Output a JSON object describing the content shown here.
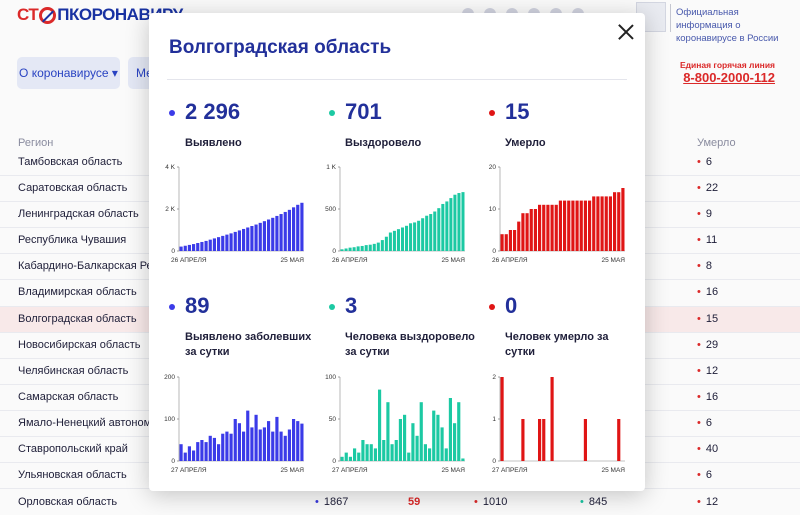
{
  "header": {
    "logo": {
      "part1": "СТ",
      "part2": "ПКОРОНАВИРУ"
    },
    "official": "Официальная информация о коронавирусе в России",
    "nav_about": "О коронавирусе ▾",
    "nav_measures": "Ме",
    "hotline_label": "Единая горячая линия",
    "hotline_phone": "8-800-2000-112"
  },
  "table": {
    "col_region": "Регион",
    "col_deaths": "Умерло",
    "rows": [
      {
        "region": "Тамбовская область",
        "deaths": "6"
      },
      {
        "region": "Саратовская область",
        "deaths": "22"
      },
      {
        "region": "Ленинградская область",
        "deaths": "9"
      },
      {
        "region": "Республика Чувашия",
        "deaths": "11"
      },
      {
        "region": "Кабардино-Балкарская Рес",
        "deaths": "8"
      },
      {
        "region": "Владимирская область",
        "deaths": "16"
      },
      {
        "region": "Волгоградская область",
        "deaths": "15"
      },
      {
        "region": "Новосибирская область",
        "deaths": "29"
      },
      {
        "region": "Челябинская область",
        "deaths": "12"
      },
      {
        "region": "Самарская область",
        "deaths": "16"
      },
      {
        "region": "Ямало-Ненецкий автономн",
        "deaths": "6"
      },
      {
        "region": "Ставропольский край",
        "deaths": "40"
      },
      {
        "region": "Ульяновская область",
        "deaths": "6"
      }
    ],
    "last_row": {
      "region": "Орловская область",
      "cases": "1867",
      "new": "59",
      "recovered": "1010",
      "recovered_new": "845",
      "deaths": "12"
    }
  },
  "modal": {
    "title": "Волгоградская область",
    "stats": [
      {
        "value": "2 296",
        "label": "Выявлено",
        "color": "#3b3be8"
      },
      {
        "value": "701",
        "label": "Выздоровело",
        "color": "#1cc9a3"
      },
      {
        "value": "15",
        "label": "Умерло",
        "color": "#e01515"
      },
      {
        "value": "89",
        "label": "Выявлено заболевших за сутки",
        "color": "#3b3be8"
      },
      {
        "value": "3",
        "label": "Человека выздоровело за сутки",
        "color": "#1cc9a3"
      },
      {
        "value": "0",
        "label": "Человек умерло за сутки",
        "color": "#e01515"
      }
    ]
  },
  "chart_data": [
    {
      "type": "bar",
      "title": "",
      "x_start": "26 АПРЕЛЯ",
      "x_end": "25 МАЯ",
      "yticks": [
        "0",
        "2 K",
        "4 K"
      ],
      "ylim": [
        0,
        4000
      ],
      "color": "#3b3be8",
      "values": [
        210,
        250,
        290,
        330,
        380,
        430,
        480,
        540,
        600,
        660,
        720,
        780,
        840,
        910,
        980,
        1050,
        1120,
        1190,
        1260,
        1340,
        1420,
        1500,
        1580,
        1670,
        1760,
        1860,
        1960,
        2080,
        2200,
        2296
      ]
    },
    {
      "type": "bar",
      "title": "",
      "x_start": "26 АПРЕЛЯ",
      "x_end": "25 МАЯ",
      "yticks": [
        "0",
        "500",
        "1 K"
      ],
      "ylim": [
        0,
        1000
      ],
      "color": "#1cc9a3",
      "values": [
        20,
        30,
        40,
        45,
        55,
        60,
        70,
        75,
        85,
        100,
        130,
        170,
        220,
        240,
        260,
        280,
        300,
        330,
        340,
        360,
        390,
        420,
        440,
        470,
        510,
        560,
        590,
        630,
        670,
        690,
        701
      ]
    },
    {
      "type": "bar",
      "title": "",
      "x_start": "26 АПРЕЛЯ",
      "x_end": "25 МАЯ",
      "yticks": [
        "0",
        "10",
        "20"
      ],
      "ylim": [
        0,
        20
      ],
      "color": "#e01515",
      "values": [
        4,
        4,
        5,
        5,
        7,
        9,
        9,
        10,
        10,
        11,
        11,
        11,
        11,
        11,
        12,
        12,
        12,
        12,
        12,
        12,
        12,
        12,
        13,
        13,
        13,
        13,
        13,
        14,
        14,
        15
      ]
    },
    {
      "type": "bar",
      "title": "",
      "x_start": "27 АПРЕЛЯ",
      "x_end": "25 МАЯ",
      "yticks": [
        "0",
        "100",
        "200"
      ],
      "ylim": [
        0,
        200
      ],
      "color": "#3b3be8",
      "values": [
        40,
        20,
        35,
        25,
        45,
        50,
        45,
        60,
        55,
        40,
        65,
        70,
        65,
        100,
        90,
        70,
        120,
        80,
        110,
        75,
        80,
        95,
        70,
        105,
        70,
        60,
        75,
        100,
        95,
        89
      ]
    },
    {
      "type": "bar",
      "title": "",
      "x_start": "27 АПРЕЛЯ",
      "x_end": "25 МАЯ",
      "yticks": [
        "0",
        "50",
        "100"
      ],
      "ylim": [
        0,
        100
      ],
      "color": "#1cc9a3",
      "values": [
        5,
        10,
        5,
        15,
        10,
        25,
        20,
        20,
        15,
        85,
        25,
        70,
        20,
        25,
        50,
        55,
        10,
        45,
        30,
        70,
        20,
        15,
        60,
        55,
        40,
        15,
        75,
        45,
        70,
        3
      ]
    },
    {
      "type": "bar",
      "title": "",
      "x_start": "27 АПРЕЛЯ",
      "x_end": "25 МАЯ",
      "yticks": [
        "0",
        "1",
        "2"
      ],
      "ylim": [
        0,
        2
      ],
      "color": "#e01515",
      "values": [
        2,
        0,
        0,
        0,
        0,
        1,
        0,
        0,
        0,
        1,
        1,
        0,
        2,
        0,
        0,
        0,
        0,
        0,
        0,
        0,
        1,
        0,
        0,
        0,
        0,
        0,
        0,
        0,
        1,
        0
      ]
    }
  ]
}
